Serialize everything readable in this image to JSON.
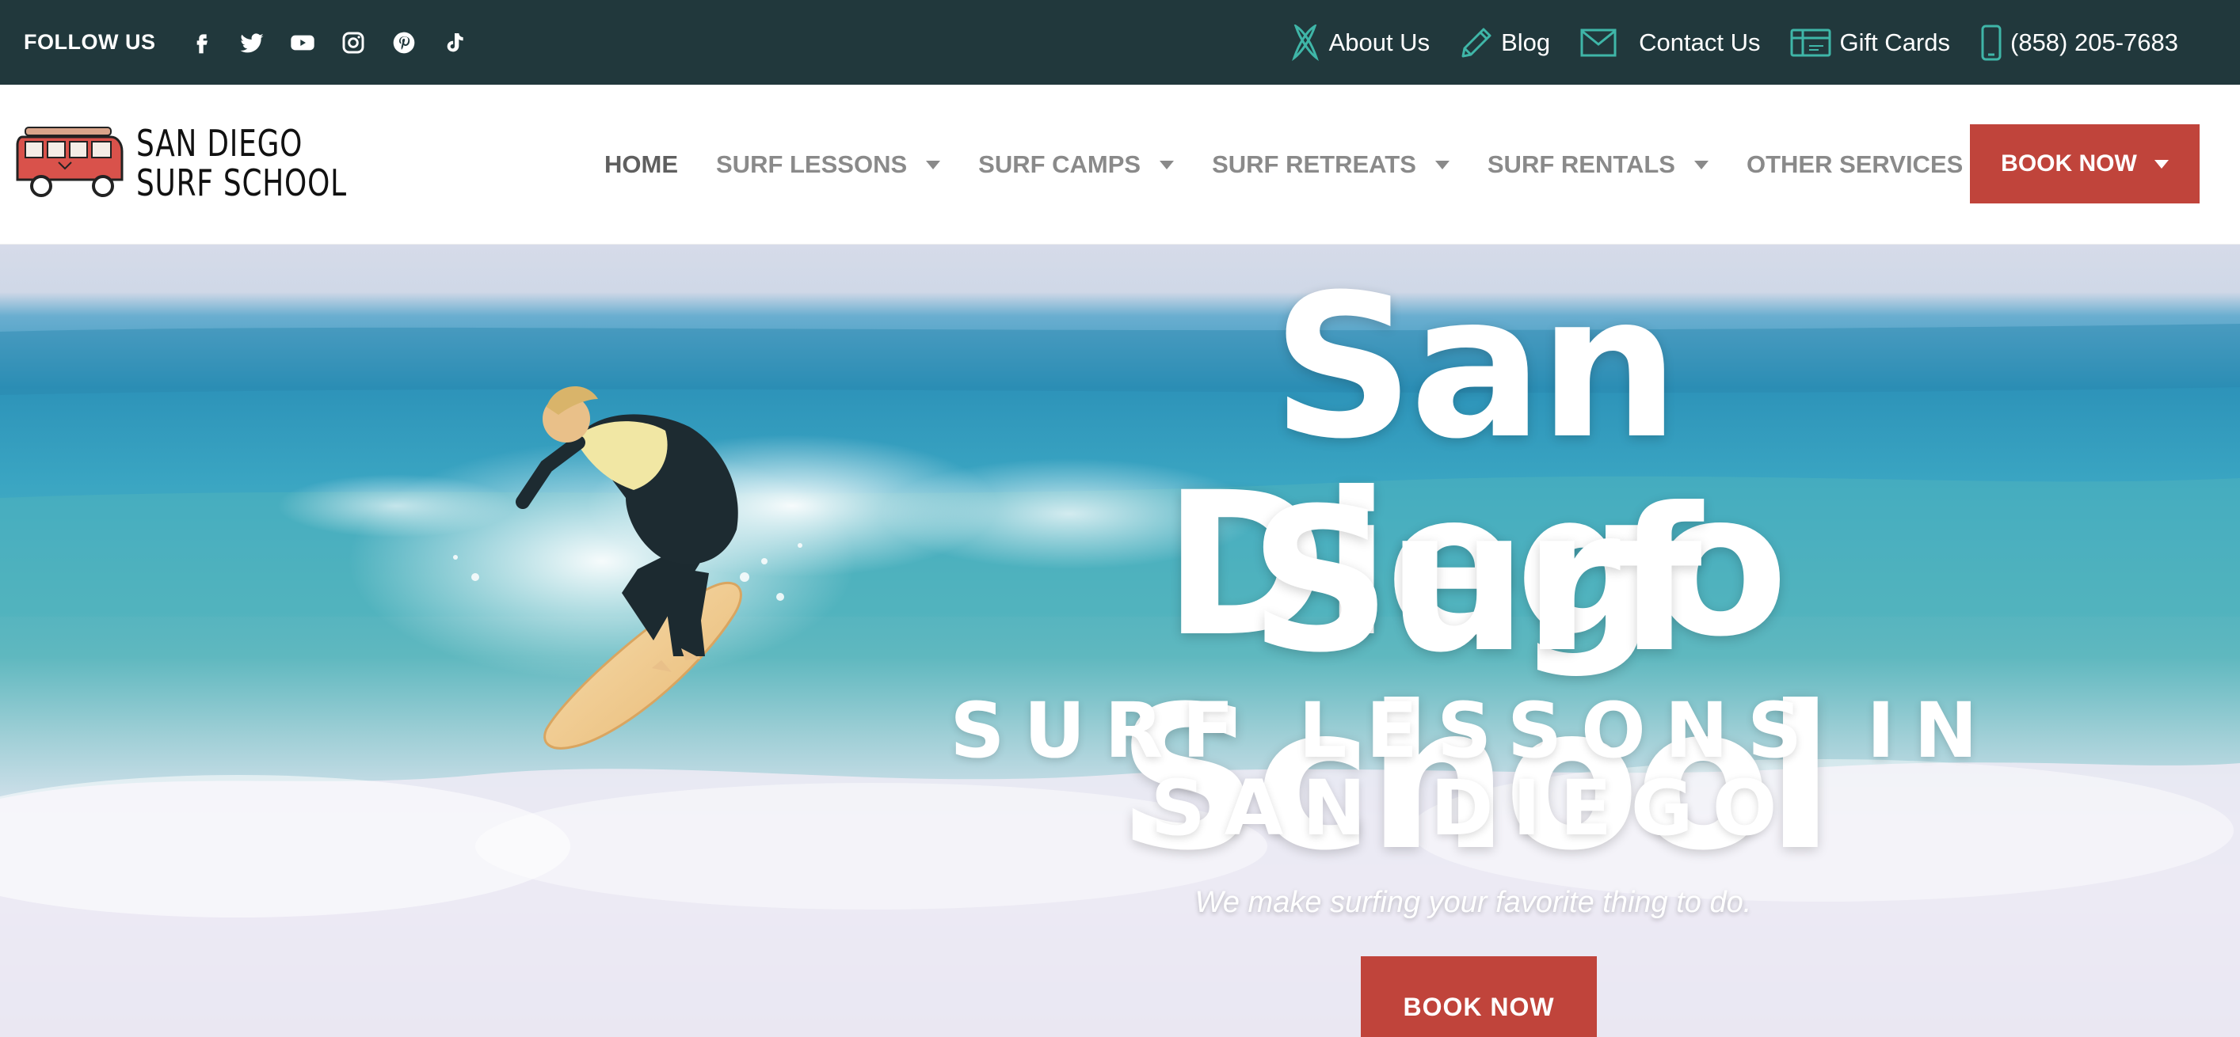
{
  "topbar": {
    "follow_label": "FOLLOW US",
    "social_icons": [
      "facebook-icon",
      "twitter-icon",
      "youtube-icon",
      "instagram-icon",
      "pinterest-icon",
      "tiktok-icon"
    ],
    "links": {
      "about": "About Us",
      "blog": "Blog",
      "contact": "Contact Us",
      "gift_cards": "Gift Cards",
      "phone": "(858) 205-7683"
    },
    "icon_color": "#3fb6a8",
    "background": "#21383c"
  },
  "logo": {
    "line1": "SAN DIEGO",
    "line2": "SURF SCHOOL"
  },
  "nav": {
    "items": [
      {
        "label": "HOME"
      },
      {
        "label": "SURF LESSONS"
      },
      {
        "label": "SURF CAMPS"
      },
      {
        "label": "SURF RETREATS"
      },
      {
        "label": "SURF RENTALS"
      },
      {
        "label": "OTHER SERVICES"
      }
    ],
    "book_now": "BOOK NOW",
    "accent": "#c0443b"
  },
  "hero": {
    "title_line1": "San Diego",
    "title_line2": "Surf School",
    "subtitle_line1": "SURF LESSONS IN",
    "subtitle_line2": "SAN DIEGO",
    "tagline": "We make surfing your favorite thing to do.",
    "cta": "BOOK NOW"
  }
}
